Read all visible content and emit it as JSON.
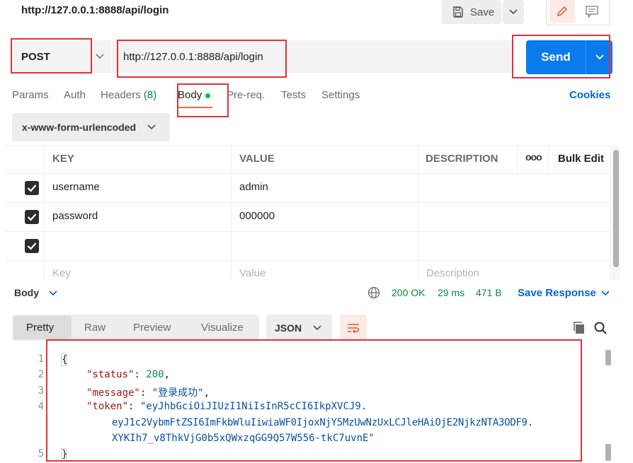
{
  "header": {
    "title": "http://127.0.0.1:8888/api/login",
    "save_label": "Save"
  },
  "request": {
    "method": "POST",
    "url": "http://127.0.0.1:8888/api/login",
    "send_label": "Send"
  },
  "tabs": [
    {
      "label": "Params"
    },
    {
      "label": "Auth"
    },
    {
      "label": "Headers",
      "count": "(8)"
    },
    {
      "label": "Body"
    },
    {
      "label": "Pre-req."
    },
    {
      "label": "Tests"
    },
    {
      "label": "Settings"
    }
  ],
  "cookies_label": "Cookies",
  "body_type": "x-www-form-urlencoded",
  "table": {
    "headers": {
      "key": "KEY",
      "value": "VALUE",
      "description": "DESCRIPTION",
      "more": "ooo",
      "bulk": "Bulk Edit"
    },
    "rows": [
      {
        "key": "username",
        "value": "admin",
        "description": ""
      },
      {
        "key": "password",
        "value": "000000",
        "description": ""
      },
      {
        "key": "",
        "value": "",
        "description": ""
      }
    ],
    "placeholders": {
      "key": "Key",
      "value": "Value",
      "description": "Description"
    }
  },
  "response": {
    "section_label": "Body",
    "status": "200 OK",
    "time": "29 ms",
    "size": "471 B",
    "save_label": "Save Response",
    "view_tabs": [
      "Pretty",
      "Raw",
      "Preview",
      "Visualize"
    ],
    "format": "JSON",
    "lines": {
      "l1": "{",
      "status_key": "\"status\"",
      "status_val": "200",
      "message_key": "\"message\"",
      "message_val": "\"登录成功\"",
      "token_key": "\"token\"",
      "token_1": "\"eyJhbGciOiJIUzI1NiIsInR5cCI6IkpXVCJ9.",
      "token_2": "eyJ1c2VybmFtZSI6ImFkbWluIiwiaWF0IjoxNjY5MzUwNzUxLCJleHAiOjE2NjkzNTA3ODF9.",
      "token_3": "XYKIh7_v8ThkVjG0b5xQWxzqGG9Q57W556-tkC7uvnE\"",
      "l5": "}"
    },
    "line_numbers": [
      "1",
      "2",
      "3",
      "4",
      "5"
    ]
  }
}
